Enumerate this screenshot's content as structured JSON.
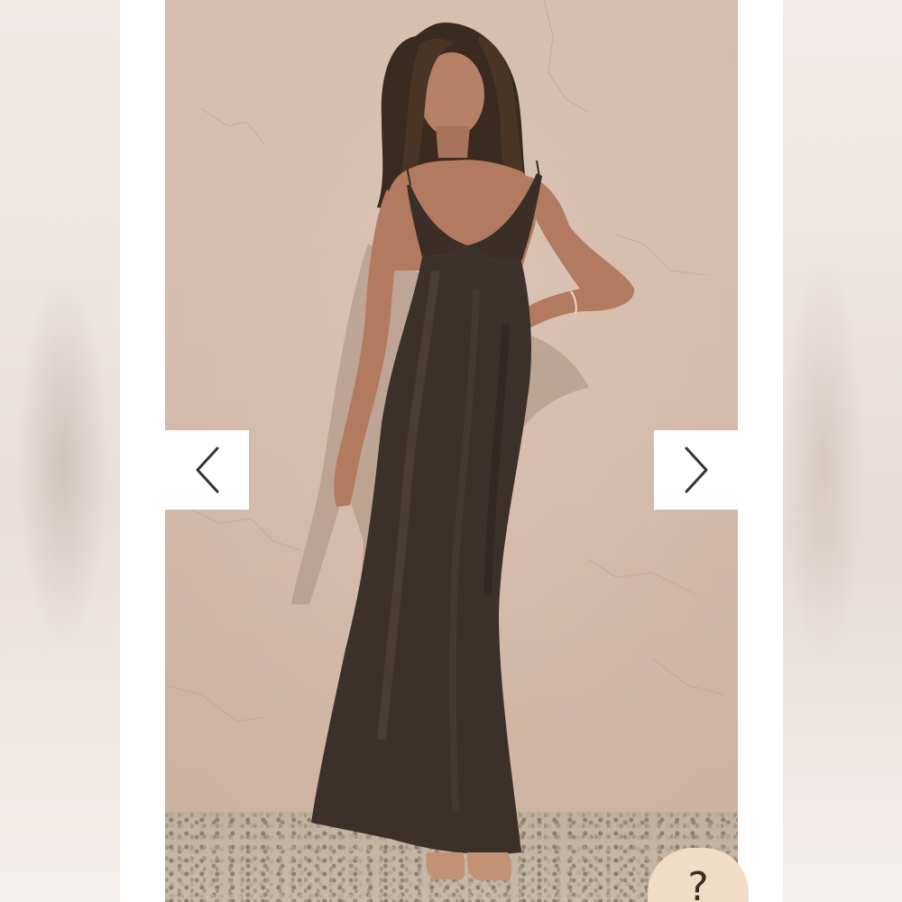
{
  "carousel": {
    "photo_alt_subject": "",
    "prev_icon": "chevron-left-icon",
    "next_icon": "chevron-right-icon"
  },
  "help_widget": {
    "label": "?",
    "icon": "help-icon"
  },
  "colors": {
    "wall": "#d7bfb0",
    "dress": "#3b302a",
    "nav_button_bg": "#ffffff",
    "help_badge_bg": "#f1dcc6"
  }
}
